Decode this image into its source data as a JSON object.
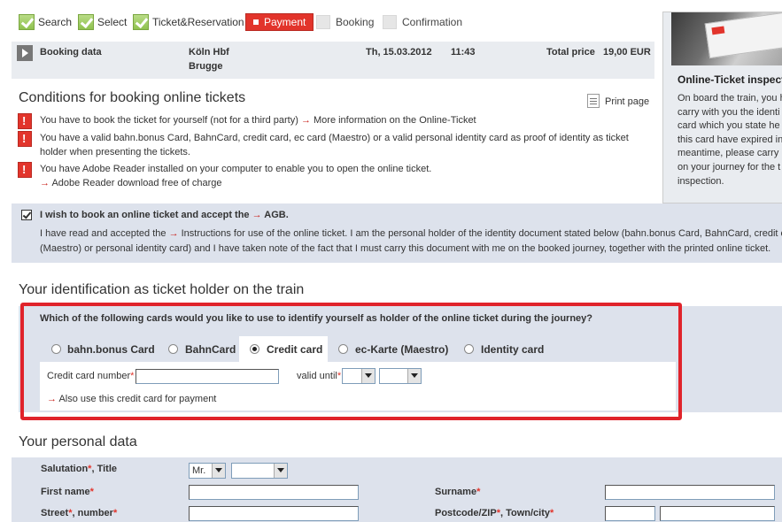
{
  "progress": {
    "steps": [
      {
        "label": "Search",
        "state": "done"
      },
      {
        "label": "Select",
        "state": "done"
      },
      {
        "label": "Ticket&Reservation",
        "state": "done"
      },
      {
        "label": "Payment",
        "state": "current"
      },
      {
        "label": "Booking",
        "state": "upcoming"
      },
      {
        "label": "Confirmation",
        "state": "upcoming"
      }
    ]
  },
  "booking": {
    "label": "Booking data",
    "from": "Köln Hbf",
    "to": "Brugge",
    "date": "Th, 15.03.2012",
    "time": "11:43",
    "total_label": "Total price",
    "total_value": "19,00 EUR"
  },
  "conditions": {
    "title": "Conditions for booking online tickets",
    "print_label": "Print page",
    "items": [
      {
        "text": "You have to book the ticket for yourself (not for a third party)",
        "link": "More information on the Online-Ticket"
      },
      {
        "line1": "You have a valid bahn.bonus Card, BahnCard, credit card, ec card (Maestro) or a valid personal identity card as proof of identity as ticket",
        "line2": "holder when presenting the tickets."
      },
      {
        "text": "You have Adobe Reader installed on your computer to enable you to open the online ticket.",
        "link": "Adobe Reader download free of charge"
      }
    ]
  },
  "accept": {
    "checked": true,
    "label": "I wish to book an online ticket and accept the",
    "agb": "AGB.",
    "line1_pre": "I have read and accepted the",
    "line1_link": "Instructions for use of the online ticket.",
    "line1_post": "I am the personal holder of the identity document stated below (bahn.bonus Card, BahnCard, credit car",
    "line2": "(Maestro) or personal identity card) and I have taken note of the fact that I must carry this document with me on the booked journey, together with the printed online ticket."
  },
  "identification": {
    "title": "Your identification as ticket holder on the train",
    "question": "Which of the following cards would you like to use to identify yourself as holder of the online ticket during the journey?",
    "options": [
      "bahn.bonus Card",
      "BahnCard",
      "Credit card",
      "ec-Karte (Maestro)",
      "Identity card"
    ],
    "selected": "Credit card",
    "cc_number_label": "Credit card number",
    "cc_number_value": "",
    "valid_until_label": "valid until",
    "valid_month": "",
    "valid_year": "",
    "payment_link": "Also use this credit card for payment"
  },
  "personal": {
    "title": "Your personal data",
    "salutation_label": "Salutation",
    "title_label": "Title",
    "salutation_value": "Mr.",
    "title_value": "",
    "first_name_label": "First name",
    "surname_label": "Surname",
    "street_label": "Street",
    "number_label": "number",
    "postcode_label": "Postcode/ZIP",
    "town_label": "Town/city",
    "first_name_value": "",
    "surname_value": "",
    "street_value": "",
    "postcode_value": "",
    "town_value": ""
  },
  "sidebar": {
    "title": "Online-Ticket inspect",
    "lines": [
      "On board the train, you h",
      "carry with you the identi",
      "card which you state he",
      "this card have expired in",
      "meantime, please carry i",
      "on your journey for the t",
      "inspection."
    ]
  }
}
